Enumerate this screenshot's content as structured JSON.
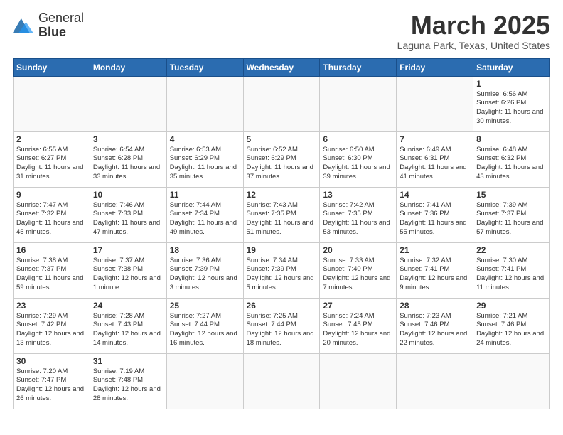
{
  "header": {
    "logo_text_normal": "General",
    "logo_text_bold": "Blue",
    "month_title": "March 2025",
    "location": "Laguna Park, Texas, United States"
  },
  "weekdays": [
    "Sunday",
    "Monday",
    "Tuesday",
    "Wednesday",
    "Thursday",
    "Friday",
    "Saturday"
  ],
  "weeks": [
    [
      {
        "day": "",
        "info": ""
      },
      {
        "day": "",
        "info": ""
      },
      {
        "day": "",
        "info": ""
      },
      {
        "day": "",
        "info": ""
      },
      {
        "day": "",
        "info": ""
      },
      {
        "day": "",
        "info": ""
      },
      {
        "day": "1",
        "info": "Sunrise: 6:56 AM\nSunset: 6:26 PM\nDaylight: 11 hours and 30 minutes."
      }
    ],
    [
      {
        "day": "2",
        "info": "Sunrise: 6:55 AM\nSunset: 6:27 PM\nDaylight: 11 hours and 31 minutes."
      },
      {
        "day": "3",
        "info": "Sunrise: 6:54 AM\nSunset: 6:28 PM\nDaylight: 11 hours and 33 minutes."
      },
      {
        "day": "4",
        "info": "Sunrise: 6:53 AM\nSunset: 6:29 PM\nDaylight: 11 hours and 35 minutes."
      },
      {
        "day": "5",
        "info": "Sunrise: 6:52 AM\nSunset: 6:29 PM\nDaylight: 11 hours and 37 minutes."
      },
      {
        "day": "6",
        "info": "Sunrise: 6:50 AM\nSunset: 6:30 PM\nDaylight: 11 hours and 39 minutes."
      },
      {
        "day": "7",
        "info": "Sunrise: 6:49 AM\nSunset: 6:31 PM\nDaylight: 11 hours and 41 minutes."
      },
      {
        "day": "8",
        "info": "Sunrise: 6:48 AM\nSunset: 6:32 PM\nDaylight: 11 hours and 43 minutes."
      }
    ],
    [
      {
        "day": "9",
        "info": "Sunrise: 7:47 AM\nSunset: 7:32 PM\nDaylight: 11 hours and 45 minutes."
      },
      {
        "day": "10",
        "info": "Sunrise: 7:46 AM\nSunset: 7:33 PM\nDaylight: 11 hours and 47 minutes."
      },
      {
        "day": "11",
        "info": "Sunrise: 7:44 AM\nSunset: 7:34 PM\nDaylight: 11 hours and 49 minutes."
      },
      {
        "day": "12",
        "info": "Sunrise: 7:43 AM\nSunset: 7:35 PM\nDaylight: 11 hours and 51 minutes."
      },
      {
        "day": "13",
        "info": "Sunrise: 7:42 AM\nSunset: 7:35 PM\nDaylight: 11 hours and 53 minutes."
      },
      {
        "day": "14",
        "info": "Sunrise: 7:41 AM\nSunset: 7:36 PM\nDaylight: 11 hours and 55 minutes."
      },
      {
        "day": "15",
        "info": "Sunrise: 7:39 AM\nSunset: 7:37 PM\nDaylight: 11 hours and 57 minutes."
      }
    ],
    [
      {
        "day": "16",
        "info": "Sunrise: 7:38 AM\nSunset: 7:37 PM\nDaylight: 11 hours and 59 minutes."
      },
      {
        "day": "17",
        "info": "Sunrise: 7:37 AM\nSunset: 7:38 PM\nDaylight: 12 hours and 1 minute."
      },
      {
        "day": "18",
        "info": "Sunrise: 7:36 AM\nSunset: 7:39 PM\nDaylight: 12 hours and 3 minutes."
      },
      {
        "day": "19",
        "info": "Sunrise: 7:34 AM\nSunset: 7:39 PM\nDaylight: 12 hours and 5 minutes."
      },
      {
        "day": "20",
        "info": "Sunrise: 7:33 AM\nSunset: 7:40 PM\nDaylight: 12 hours and 7 minutes."
      },
      {
        "day": "21",
        "info": "Sunrise: 7:32 AM\nSunset: 7:41 PM\nDaylight: 12 hours and 9 minutes."
      },
      {
        "day": "22",
        "info": "Sunrise: 7:30 AM\nSunset: 7:41 PM\nDaylight: 12 hours and 11 minutes."
      }
    ],
    [
      {
        "day": "23",
        "info": "Sunrise: 7:29 AM\nSunset: 7:42 PM\nDaylight: 12 hours and 13 minutes."
      },
      {
        "day": "24",
        "info": "Sunrise: 7:28 AM\nSunset: 7:43 PM\nDaylight: 12 hours and 14 minutes."
      },
      {
        "day": "25",
        "info": "Sunrise: 7:27 AM\nSunset: 7:44 PM\nDaylight: 12 hours and 16 minutes."
      },
      {
        "day": "26",
        "info": "Sunrise: 7:25 AM\nSunset: 7:44 PM\nDaylight: 12 hours and 18 minutes."
      },
      {
        "day": "27",
        "info": "Sunrise: 7:24 AM\nSunset: 7:45 PM\nDaylight: 12 hours and 20 minutes."
      },
      {
        "day": "28",
        "info": "Sunrise: 7:23 AM\nSunset: 7:46 PM\nDaylight: 12 hours and 22 minutes."
      },
      {
        "day": "29",
        "info": "Sunrise: 7:21 AM\nSunset: 7:46 PM\nDaylight: 12 hours and 24 minutes."
      }
    ],
    [
      {
        "day": "30",
        "info": "Sunrise: 7:20 AM\nSunset: 7:47 PM\nDaylight: 12 hours and 26 minutes."
      },
      {
        "day": "31",
        "info": "Sunrise: 7:19 AM\nSunset: 7:48 PM\nDaylight: 12 hours and 28 minutes."
      },
      {
        "day": "",
        "info": ""
      },
      {
        "day": "",
        "info": ""
      },
      {
        "day": "",
        "info": ""
      },
      {
        "day": "",
        "info": ""
      },
      {
        "day": "",
        "info": ""
      }
    ]
  ]
}
